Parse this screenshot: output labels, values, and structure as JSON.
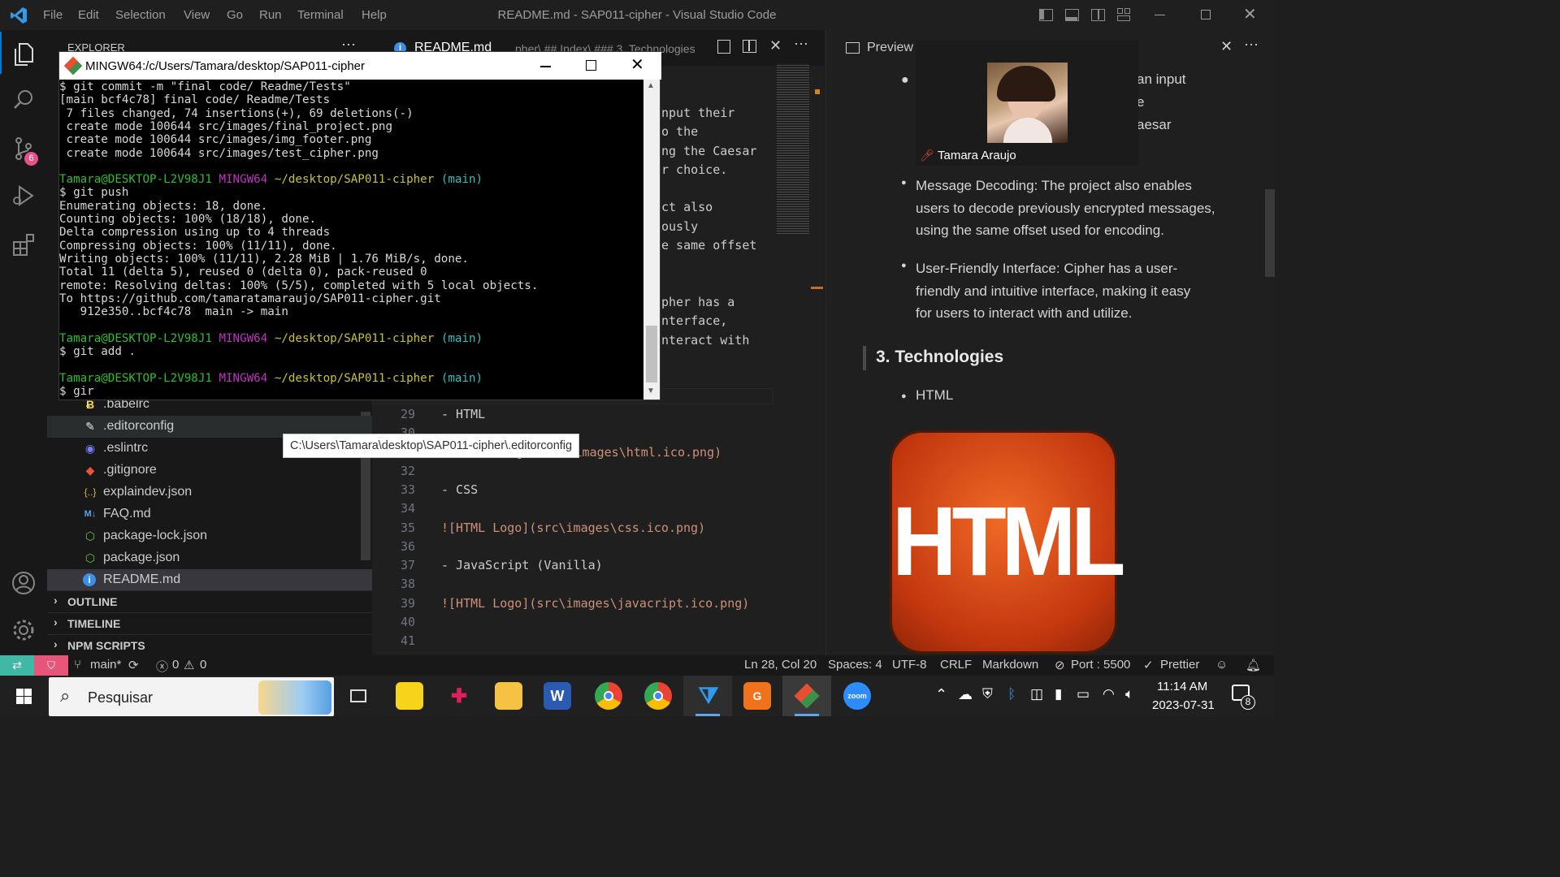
{
  "window": {
    "title": "README.md - SAP011-cipher - Visual Studio Code",
    "menu": [
      "File",
      "Edit",
      "Selection",
      "View",
      "Go",
      "Run",
      "Terminal",
      "Help"
    ]
  },
  "activity_bar": {
    "icons": [
      "files-icon",
      "search-icon",
      "source-control-icon",
      "run-debug-icon",
      "extensions-icon",
      "account-icon",
      "settings-gear-icon"
    ],
    "scm_badge": "6"
  },
  "sidebar": {
    "header": "EXPLORER",
    "files": [
      {
        "name": ".babelrc",
        "icon": "babel-icon"
      },
      {
        "name": ".editorconfig",
        "icon": "editorconfig-icon"
      },
      {
        "name": ".eslintrc",
        "icon": "eslint-icon"
      },
      {
        "name": ".gitignore",
        "icon": "git-icon"
      },
      {
        "name": "explaindev.json",
        "icon": "json-icon"
      },
      {
        "name": "FAQ.md",
        "icon": "markdown-icon"
      },
      {
        "name": "package-lock.json",
        "icon": "node-icon"
      },
      {
        "name": "package.json",
        "icon": "node-icon"
      },
      {
        "name": "README.md",
        "icon": "info-icon"
      }
    ],
    "sections": [
      "OUTLINE",
      "TIMELINE",
      "NPM SCRIPTS"
    ],
    "tooltip": "C:\\Users\\Tamara\\desktop\\SAP011-cipher\\.editorconfig"
  },
  "editor": {
    "tab": "README.md",
    "breadcrumb": "pher\\ ## Index\\ ### 3. Technologies",
    "partial_lines": [
      "nput their",
      "o the",
      "ng the Caesar",
      "r choice.",
      "ct also",
      "ously",
      "e same offset",
      "pher has a",
      "nterface,",
      "nteract with"
    ],
    "lines": [
      {
        "n": "29",
        "text": "- HTML"
      },
      {
        "n": "30",
        "text": ""
      },
      {
        "n": "31",
        "text": "![HTML Logo](src\\images\\html.ico.png)"
      },
      {
        "n": "32",
        "text": ""
      },
      {
        "n": "33",
        "text": "- CSS"
      },
      {
        "n": "34",
        "text": ""
      },
      {
        "n": "35",
        "text": "![HTML Logo](src\\images\\css.ico.png)"
      },
      {
        "n": "36",
        "text": ""
      },
      {
        "n": "37",
        "text": "- JavaScript (Vanilla)"
      },
      {
        "n": "38",
        "text": ""
      },
      {
        "n": "39",
        "text": "![HTML Logo](src\\images\\javacript.ico.png)"
      },
      {
        "n": "40",
        "text": ""
      },
      {
        "n": "41",
        "text": ""
      }
    ]
  },
  "preview": {
    "tab": "Preview",
    "top_fragments": [
      "an input",
      "e",
      "aesar"
    ],
    "bullets": [
      "Message Decoding: The project also enables users to decode previously encrypted messages, using the same offset used for encoding.",
      "User-Friendly Interface: Cipher has a user-friendly and intuitive interface, making it easy for users to interact with and utilize."
    ],
    "heading": "3. Technologies",
    "tech_item": "HTML",
    "logo_text": "HTML"
  },
  "video_call": {
    "participant": "Tamara Araujo"
  },
  "terminal": {
    "title": "MINGW64:/c/Users/Tamara/desktop/SAP011-cipher",
    "lines": [
      {
        "t": "$ git commit -m \"final code/ Readme/Tests\""
      },
      {
        "t": "[main bcf4c78] final code/ Readme/Tests"
      },
      {
        "t": " 7 files changed, 74 insertions(+), 69 deletions(-)"
      },
      {
        "t": " create mode 100644 src/images/final_project.png"
      },
      {
        "t": " create mode 100644 src/images/img_footer.png"
      },
      {
        "t": " create mode 100644 src/images/test_cipher.png"
      },
      {
        "t": ""
      },
      {
        "prompt": true
      },
      {
        "t": "$ git push"
      },
      {
        "t": "Enumerating objects: 18, done."
      },
      {
        "t": "Counting objects: 100% (18/18), done."
      },
      {
        "t": "Delta compression using up to 4 threads"
      },
      {
        "t": "Compressing objects: 100% (11/11), done."
      },
      {
        "t": "Writing objects: 100% (11/11), 2.28 MiB | 1.76 MiB/s, done."
      },
      {
        "t": "Total 11 (delta 5), reused 0 (delta 0), pack-reused 0"
      },
      {
        "t": "remote: Resolving deltas: 100% (5/5), completed with 5 local objects."
      },
      {
        "t": "To https://github.com/tamaratamaraujo/SAP011-cipher.git"
      },
      {
        "t": "   912e350..bcf4c78  main -> main"
      },
      {
        "t": ""
      },
      {
        "prompt": true
      },
      {
        "t": "$ git add ."
      },
      {
        "t": ""
      },
      {
        "prompt": true
      },
      {
        "t": "$ gir"
      }
    ],
    "prompt": {
      "user": "Tamara@DESKTOP-L2V98J1",
      "shell": "MINGW64",
      "path": "~/desktop/SAP011-cipher",
      "branch": "(main)"
    }
  },
  "status_bar": {
    "branch": "main*",
    "errors": "0",
    "warnings": "0",
    "position": "Ln 28, Col 20",
    "spaces": "Spaces: 4",
    "encoding": "UTF-8",
    "eol": "CRLF",
    "language": "Markdown",
    "port": "Port : 5500",
    "prettier": "Prettier"
  },
  "taskbar": {
    "search": "Pesquisar",
    "time": "11:14 AM",
    "date": "2023-07-31",
    "notifications": "8",
    "apps": [
      "task-view-icon",
      "sticky-notes-icon",
      "slack-icon",
      "file-explorer-icon",
      "word-icon",
      "chrome-icon",
      "chrome-profile-icon",
      "vscode-icon",
      "pdf-icon",
      "git-icon",
      "zoom-icon"
    ],
    "zoom_label": "zoom"
  },
  "colors": {
    "accent": "#0078d4",
    "status_remote": "#3fb8a6",
    "prompt_green": "#2bbf2b",
    "prompt_magenta": "#c132c1",
    "prompt_yellow": "#c9c130",
    "prompt_cyan": "#2bc0c0"
  }
}
